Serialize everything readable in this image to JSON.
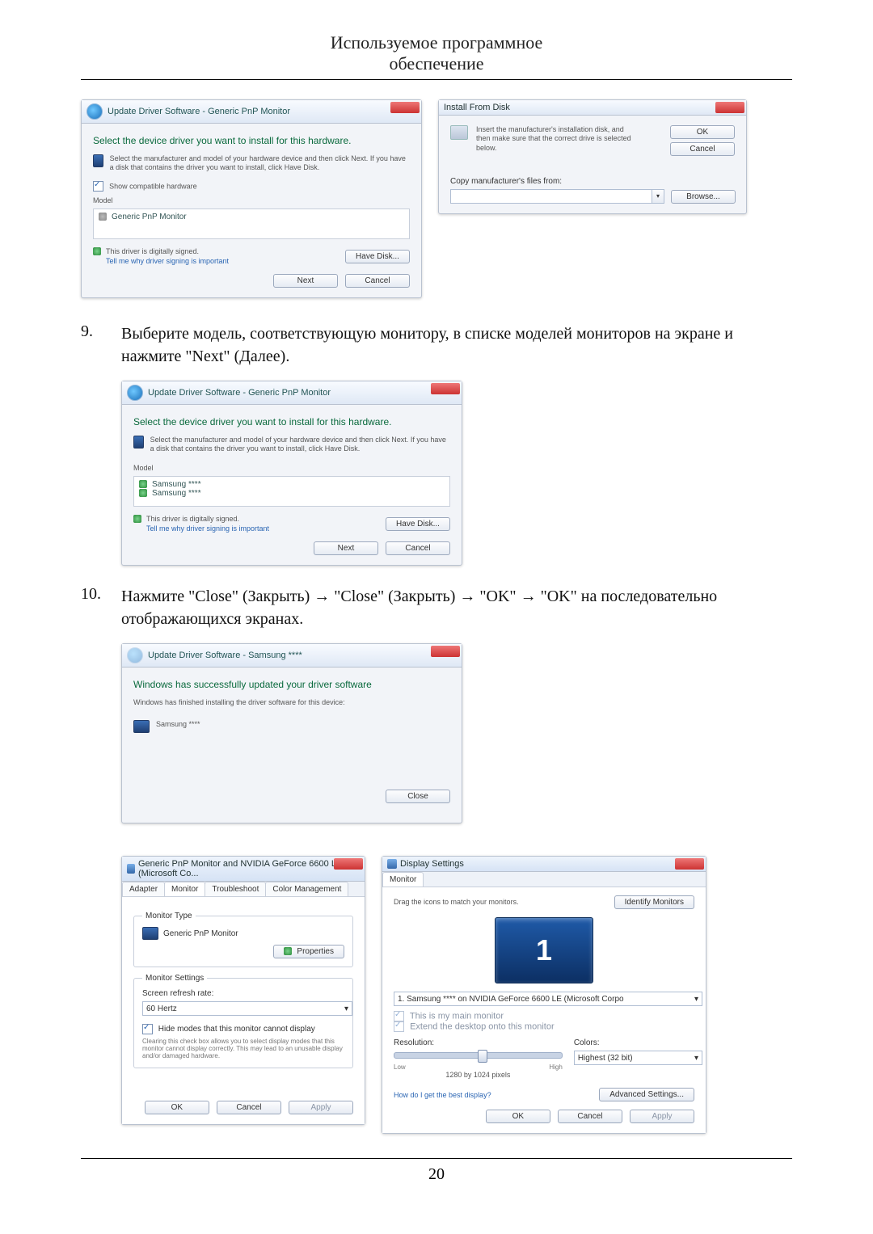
{
  "header": {
    "line1": "Используемое программное",
    "line2": "обеспечение"
  },
  "fig1": {
    "crumb": "Update Driver Software - Generic PnP Monitor",
    "title": "Select the device driver you want to install for this hardware.",
    "instr": "Select the manufacturer and model of your hardware device and then click Next. If you have a disk that contains the driver you want to install, click Have Disk.",
    "showCompat": "Show compatible hardware",
    "modelLabel": "Model",
    "modelItem": "Generic PnP Monitor",
    "signed": "This driver is digitally signed.",
    "whyLink": "Tell me why driver signing is important",
    "haveDisk": "Have Disk...",
    "next": "Next",
    "cancel": "Cancel"
  },
  "fig2": {
    "title": "Install From Disk",
    "msg": "Insert the manufacturer's installation disk, and then make sure that the correct drive is selected below.",
    "ok": "OK",
    "cancel": "Cancel",
    "copyLabel": "Copy manufacturer's files from:",
    "browse": "Browse..."
  },
  "step9": {
    "num": "9.",
    "text": "Выберите модель, соответствующую монитору, в списке моделей мониторов на экране и нажмите \"Next\" (Далее)."
  },
  "fig3": {
    "crumb": "Update Driver Software - Generic PnP Monitor",
    "title": "Select the device driver you want to install for this hardware.",
    "instr": "Select the manufacturer and model of your hardware device and then click Next. If you have a disk that contains the driver you want to install, click Have Disk.",
    "modelLabel": "Model",
    "item1": "Samsung ****",
    "item2": "Samsung ****",
    "signed": "This driver is digitally signed.",
    "whyLink": "Tell me why driver signing is important",
    "haveDisk": "Have Disk...",
    "next": "Next",
    "cancel": "Cancel"
  },
  "step10": {
    "num": "10.",
    "text": "Нажмите \"Close\" (Закрыть) → \"Close\" (Закрыть) → \"OK\" → \"OK\" на последовательно отображающихся экранах."
  },
  "fig4": {
    "crumb": "Update Driver Software - Samsung ****",
    "title": "Windows has successfully updated your driver software",
    "sub": "Windows has finished installing the driver software for this device:",
    "item": "Samsung ****",
    "close": "Close"
  },
  "fig5": {
    "title": "Generic PnP Monitor and NVIDIA GeForce 6600 LE (Microsoft Co...",
    "tabs": {
      "adapter": "Adapter",
      "monitor": "Monitor",
      "troubleshoot": "Troubleshoot",
      "color": "Color Management"
    },
    "monType": "Monitor Type",
    "monName": "Generic PnP Monitor",
    "properties": "Properties",
    "monSettings": "Monitor Settings",
    "refreshLabel": "Screen refresh rate:",
    "refreshVal": "60 Hertz",
    "hideModes": "Hide modes that this monitor cannot display",
    "hideDesc": "Clearing this check box allows you to select display modes that this monitor cannot display correctly. This may lead to an unusable display and/or damaged hardware.",
    "ok": "OK",
    "cancel": "Cancel",
    "apply": "Apply"
  },
  "fig6": {
    "title": "Display Settings",
    "tab": "Monitor",
    "drag": "Drag the icons to match your monitors.",
    "identify": "Identify Monitors",
    "previewNum": "1",
    "monitorSel": "1. Samsung **** on NVIDIA GeForce 6600 LE (Microsoft Corpo",
    "mainMon": "This is my main monitor",
    "extend": "Extend the desktop onto this monitor",
    "resLabel": "Resolution:",
    "low": "Low",
    "high": "High",
    "resVal": "1280 by 1024 pixels",
    "colorsLabel": "Colors:",
    "colorsVal": "Highest (32 bit)",
    "helpLink": "How do I get the best display?",
    "adv": "Advanced Settings...",
    "ok": "OK",
    "cancel": "Cancel",
    "apply": "Apply"
  },
  "pageNumber": "20"
}
